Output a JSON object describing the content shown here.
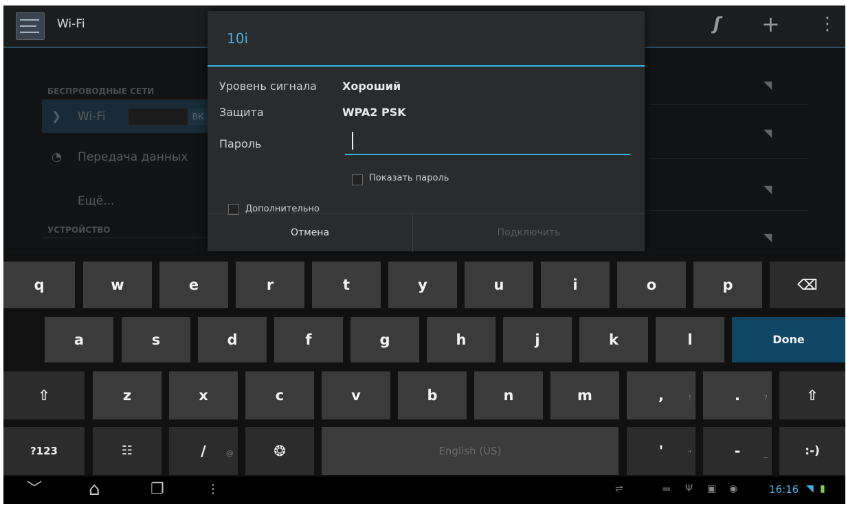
{
  "action_bar": {
    "title": "Wi-Fi",
    "sync_icon": "ʃ",
    "add_icon": "+",
    "menu_icon": "⋮"
  },
  "settings": {
    "section_wireless": "БЕСПРОВОДНЫЕ СЕТИ",
    "wifi_label": "Wi-Fi",
    "wifi_toggle": "ВК",
    "data_usage_label": "Передача данных",
    "more_label": "Ещё...",
    "section_device": "УСТРОЙСТВО",
    "wifi_icon": "❯",
    "data_icon": "◔"
  },
  "dialog": {
    "title": "10i",
    "signal_label": "Уровень сигнала",
    "signal_value": "Хороший",
    "security_label": "Защита",
    "security_value": "WPA2 PSK",
    "password_label": "Пароль",
    "password_value": "",
    "show_password_label": "Показать пароль",
    "advanced_label": "Дополнительно",
    "cancel_label": "Отмена",
    "connect_label": "Подключить"
  },
  "keyboard": {
    "row1": [
      "q",
      "w",
      "e",
      "r",
      "t",
      "y",
      "u",
      "i",
      "o",
      "p"
    ],
    "row2": [
      "a",
      "s",
      "d",
      "f",
      "g",
      "h",
      "j",
      "k",
      "l"
    ],
    "row3": [
      "z",
      "x",
      "c",
      "v",
      "b",
      "n",
      "m"
    ],
    "backspace_icon": "⌫",
    "done_label": "Done",
    "shift_icon": "⇧",
    "comma": ",",
    "comma_hint": "!",
    "period": ".",
    "period_hint": "?",
    "symbols_label": "?123",
    "settings_icon": "☷",
    "slash": "/",
    "slash_hint": "@",
    "globe_icon": "❂",
    "space_label": "English (US)",
    "apostrophe": "'",
    "apostrophe_hint": "\"",
    "dash": "-",
    "dash_hint": "_",
    "smiley": ":-)"
  },
  "navbar": {
    "back_icon": "﹀",
    "home_icon": "⌂",
    "recent_icon": "❐",
    "more_icon": "⋮",
    "clock": "16:16",
    "status_icons": [
      "⇌",
      "▬",
      "Ψ",
      "▣",
      "◉"
    ],
    "wifi_status_icon": "◥",
    "battery_icon": "▮"
  }
}
